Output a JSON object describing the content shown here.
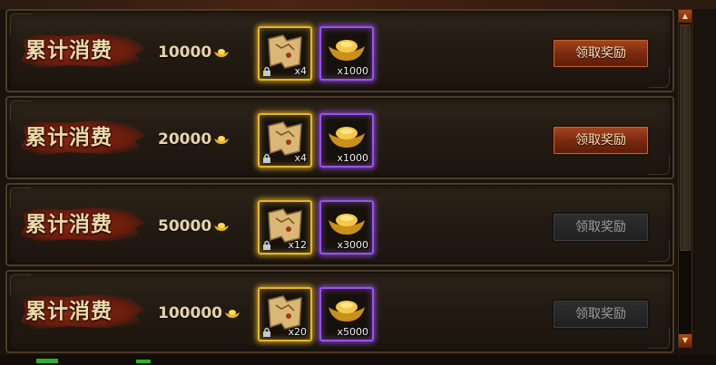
{
  "rewards": [
    {
      "label": "累计消费",
      "amount": "10000",
      "items": [
        {
          "qty": "x4",
          "type": "treasure-map"
        },
        {
          "qty": "x1000",
          "type": "gold-ingot"
        }
      ],
      "button": "领取奖励",
      "button_state": "active"
    },
    {
      "label": "累计消费",
      "amount": "20000",
      "items": [
        {
          "qty": "x4",
          "type": "treasure-map"
        },
        {
          "qty": "x1000",
          "type": "gold-ingot"
        }
      ],
      "button": "领取奖励",
      "button_state": "active"
    },
    {
      "label": "累计消费",
      "amount": "50000",
      "items": [
        {
          "qty": "x12",
          "type": "treasure-map"
        },
        {
          "qty": "x3000",
          "type": "gold-ingot"
        }
      ],
      "button": "领取奖励",
      "button_state": "disabled"
    },
    {
      "label": "累计消费",
      "amount": "100000",
      "items": [
        {
          "qty": "x20",
          "type": "treasure-map"
        },
        {
          "qty": "x5000",
          "type": "gold-ingot"
        }
      ],
      "button": "领取奖励",
      "button_state": "disabled"
    }
  ],
  "scrollbar": {
    "up_icon": "arrow-up-icon",
    "down_icon": "arrow-down-icon"
  },
  "colors": {
    "gold_frame": "#e5b629",
    "purple_frame": "#9a52f0",
    "active_button": "#7a2a10",
    "disabled_button": "#202020"
  }
}
